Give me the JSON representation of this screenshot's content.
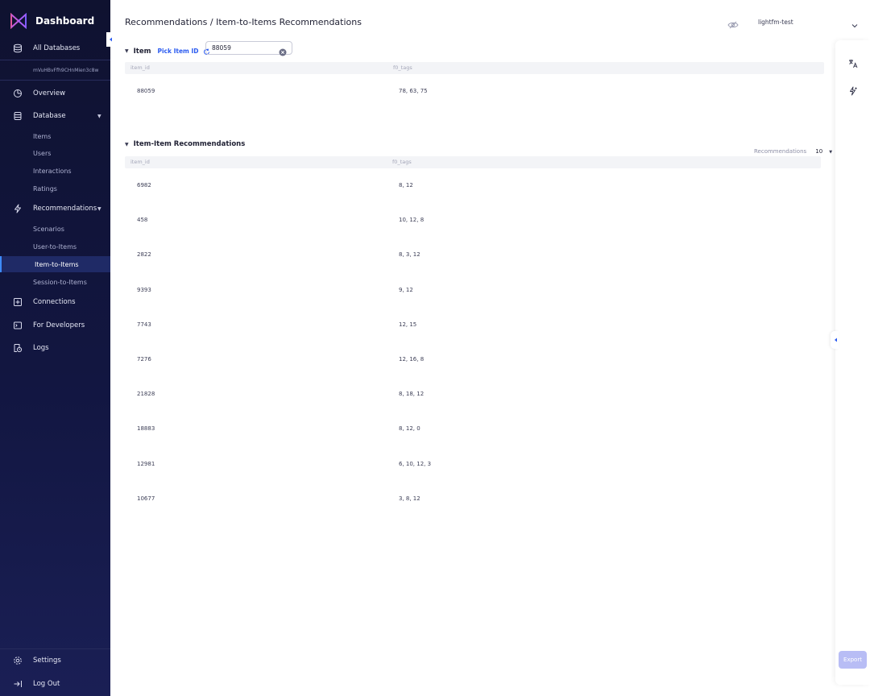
{
  "sidebar": {
    "brand": "Dashboard",
    "all_databases": "All Databases",
    "database_id": "mVuHBvFfh9CHnMien3c8w",
    "overview": "Overview",
    "database": "Database",
    "database_sub": [
      "Items",
      "Users",
      "Interactions",
      "Ratings"
    ],
    "recommendations": "Recommendations",
    "recommendations_sub": [
      "Scenarios",
      "User-to-Items",
      "Item-to-Items",
      "Session-to-Items"
    ],
    "active_sub": "Item-to-Items",
    "connections": "Connections",
    "for_developers": "For Developers",
    "logs": "Logs",
    "settings": "Settings",
    "log_out": "Log Out"
  },
  "header": {
    "breadcrumb": "Recommendations / Item-to-Items Recommendations",
    "database_select": "lightfm-test"
  },
  "item_section": {
    "title": "Item",
    "pick_label": "Pick Item ID",
    "input_value": "88059",
    "columns": [
      "item_id",
      "f0_tags"
    ],
    "rows": [
      [
        "88059",
        "78, 63, 75"
      ]
    ]
  },
  "recs_section": {
    "title": "Item-Item Recommendations",
    "count_label": "Recommendations",
    "count_value": "10",
    "columns": [
      "item_id",
      "f0_tags"
    ],
    "rows": [
      [
        "6982",
        "8, 12"
      ],
      [
        "458",
        "10, 12, 8"
      ],
      [
        "2822",
        "8, 3, 12"
      ],
      [
        "9393",
        "9, 12"
      ],
      [
        "7743",
        "12, 15"
      ],
      [
        "7276",
        "12, 16, 8"
      ],
      [
        "21828",
        "8, 18, 12"
      ],
      [
        "18883",
        "8, 12, 0"
      ],
      [
        "12981",
        "6, 10, 12, 3"
      ],
      [
        "10677",
        "3, 8, 12"
      ]
    ]
  },
  "right_rail": {
    "export_label": "Export"
  },
  "colors": {
    "sidebar_bg": "#121641",
    "accent": "#3d8bff",
    "link": "#2c5cf0",
    "export_button": "#b8bdf5"
  }
}
